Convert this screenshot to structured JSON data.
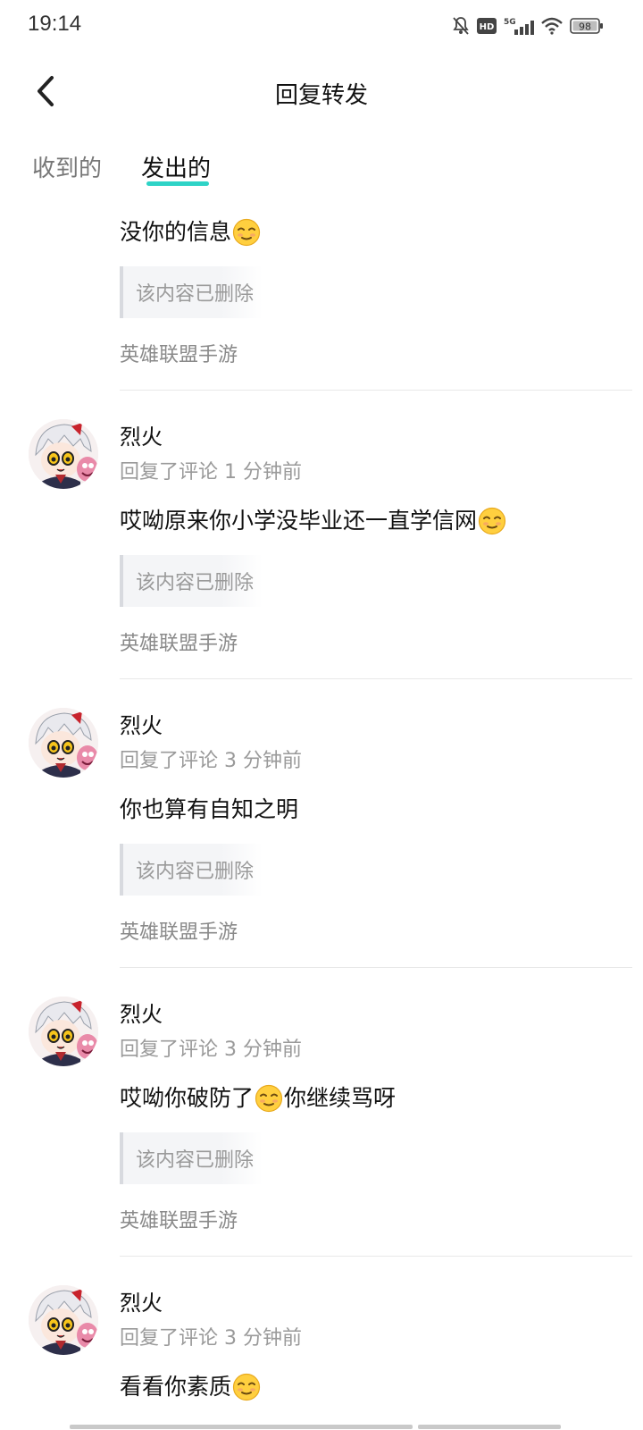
{
  "status_bar": {
    "time": "19:14",
    "battery": "98",
    "network": "5G",
    "hd": "HD",
    "icons": [
      "mute-bell-icon",
      "hd-icon",
      "signal-5g-icon",
      "wifi-icon",
      "battery-icon"
    ]
  },
  "header": {
    "title": "回复转发",
    "back_icon": "chevron-left-icon"
  },
  "tabs": {
    "received": "收到的",
    "sent": "发出的",
    "active": "sent",
    "accent": "#2ed3c6"
  },
  "items": [
    {
      "has_header": false,
      "content": "没你的信息",
      "content_suffix": "",
      "emoji_after": true,
      "quote": "该内容已删除",
      "source": "英雄联盟手游"
    },
    {
      "has_header": true,
      "name": "烈火",
      "meta": "回复了评论 1 分钟前",
      "content": "哎呦原来你小学没毕业还一直学信网",
      "content_suffix": "",
      "emoji_after": true,
      "quote": "该内容已删除",
      "source": "英雄联盟手游"
    },
    {
      "has_header": true,
      "name": "烈火",
      "meta": "回复了评论 3 分钟前",
      "content": "你也算有自知之明",
      "content_suffix": "",
      "emoji_after": false,
      "quote": "该内容已删除",
      "source": "英雄联盟手游"
    },
    {
      "has_header": true,
      "name": "烈火",
      "meta": "回复了评论 3 分钟前",
      "content": "哎呦你破防了",
      "content_suffix": "你继续骂呀",
      "emoji_after": true,
      "quote": "该内容已删除",
      "source": "英雄联盟手游"
    },
    {
      "has_header": true,
      "name": "烈火",
      "meta": "回复了评论 3 分钟前",
      "content": "看看你素质",
      "content_suffix": "",
      "emoji_after": true,
      "quote": "",
      "source": ""
    }
  ],
  "emoji_name": "smug-face-emoji"
}
